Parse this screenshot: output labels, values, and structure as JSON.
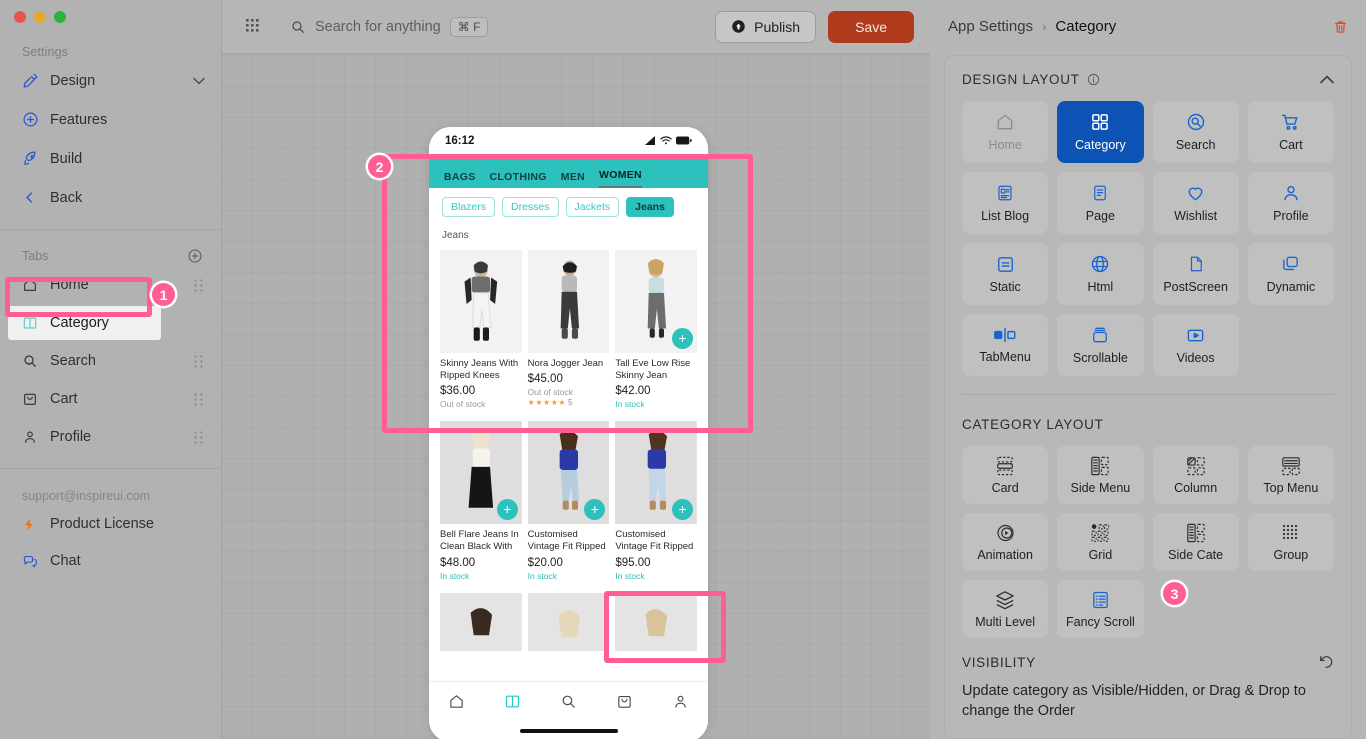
{
  "sidebar": {
    "settings_label": "Settings",
    "settings_items": [
      {
        "label": "Design",
        "icon": "paint-roller-icon",
        "trailing": "chevron-down-icon"
      },
      {
        "label": "Features",
        "icon": "plus-circle-icon",
        "trailing": ""
      },
      {
        "label": "Build",
        "icon": "rocket-icon",
        "trailing": ""
      },
      {
        "label": "Back",
        "icon": "chevron-left-icon",
        "trailing": ""
      }
    ],
    "tabs_label": "Tabs",
    "add_tab_icon": "plus-circle-icon",
    "tabs": [
      {
        "label": "Home",
        "icon": "home-icon",
        "selected": false
      },
      {
        "label": "Category",
        "icon": "category-icon",
        "selected": true
      },
      {
        "label": "Search",
        "icon": "search-icon",
        "selected": false
      },
      {
        "label": "Cart",
        "icon": "cart-icon",
        "selected": false
      },
      {
        "label": "Profile",
        "icon": "person-icon",
        "selected": false
      }
    ],
    "support_email": "support@inspireui.com",
    "links": [
      {
        "label": "Product License",
        "icon": "bolt-icon"
      },
      {
        "label": "Chat",
        "icon": "chat-icon"
      }
    ]
  },
  "topbar": {
    "apps_icon": "grid-apps-icon",
    "search_icon": "search-icon",
    "search_placeholder": "Search for anything",
    "search_shortcut": "⌘ F",
    "publish_label": "Publish",
    "publish_icon": "upload-circle-icon",
    "save_label": "Save",
    "save_color": "#b03b1c"
  },
  "breadcrumb": {
    "parent": "App Settings",
    "separator": "›",
    "current": "Category",
    "delete_icon": "trash-icon",
    "delete_color": "#d9432c"
  },
  "phone": {
    "status_time": "16:12",
    "status_icons": [
      "signal-icon",
      "wifi-icon",
      "battery-icon"
    ],
    "top_tabs": [
      "BAGS",
      "CLOTHING",
      "MEN",
      "WOMEN"
    ],
    "top_tab_active": "WOMEN",
    "accent_color": "#2cc1bd",
    "chips": [
      "Blazers",
      "Dresses",
      "Jackets",
      "Jeans"
    ],
    "chip_active": "Jeans",
    "section_title": "Jeans",
    "products_row1": [
      {
        "name": "Skinny Jeans With Ripped Knees",
        "price": "$36.00",
        "status": "Out of stock",
        "in_stock": false,
        "fab": false,
        "rating": ""
      },
      {
        "name": "Nora Jogger Jean",
        "price": "$45.00",
        "status": "Out of stock",
        "in_stock": false,
        "fab": false,
        "rating": "5"
      },
      {
        "name": "Tall Eve Low Rise Skinny Jean",
        "price": "$42.00",
        "status": "In stock",
        "in_stock": true,
        "fab": true,
        "rating": ""
      }
    ],
    "products_row2": [
      {
        "name": "Bell Flare Jeans In Clean Black With",
        "price": "$48.00",
        "status": "In stock",
        "in_stock": true,
        "fab": true,
        "rating": ""
      },
      {
        "name": "Customised Vintage Fit Ripped",
        "price": "$20.00",
        "status": "In stock",
        "in_stock": true,
        "fab": true,
        "rating": ""
      },
      {
        "name": "Customised Vintage Fit Ripped",
        "price": "$95.00",
        "status": "In stock",
        "in_stock": true,
        "fab": true,
        "rating": ""
      }
    ],
    "bottom_nav": [
      {
        "icon": "home-icon",
        "active": false
      },
      {
        "icon": "category-icon",
        "active": true
      },
      {
        "icon": "search-icon",
        "active": false
      },
      {
        "icon": "bag-icon",
        "active": false
      },
      {
        "icon": "person-icon",
        "active": false
      }
    ]
  },
  "design_layout": {
    "title": "DESIGN LAYOUT",
    "info_icon": "info-icon",
    "collapse_icon": "chevron-up-icon",
    "active_color": "#0d52b5",
    "tiles": [
      {
        "label": "Home",
        "icon": "home-icon",
        "state": "dim"
      },
      {
        "label": "Category",
        "icon": "grid-4-icon",
        "state": "active"
      },
      {
        "label": "Search",
        "icon": "search-circle-icon",
        "state": "normal"
      },
      {
        "label": "Cart",
        "icon": "cart-icon",
        "state": "normal"
      },
      {
        "label": "List Blog",
        "icon": "list-blog-icon",
        "state": "normal"
      },
      {
        "label": "Page",
        "icon": "page-icon",
        "state": "normal"
      },
      {
        "label": "Wishlist",
        "icon": "heart-icon",
        "state": "normal"
      },
      {
        "label": "Profile",
        "icon": "person-icon",
        "state": "normal"
      },
      {
        "label": "Static",
        "icon": "static-icon",
        "state": "normal"
      },
      {
        "label": "Html",
        "icon": "globe-icon",
        "state": "normal"
      },
      {
        "label": "PostScreen",
        "icon": "document-icon",
        "state": "normal"
      },
      {
        "label": "Dynamic",
        "icon": "layers-icon",
        "state": "normal"
      },
      {
        "label": "TabMenu",
        "icon": "tabmenu-icon",
        "state": "normal"
      },
      {
        "label": "Scrollable",
        "icon": "scrollable-icon",
        "state": "normal"
      },
      {
        "label": "Videos",
        "icon": "video-icon",
        "state": "normal"
      }
    ]
  },
  "category_layout": {
    "title": "CATEGORY LAYOUT",
    "tiles": [
      {
        "label": "Card",
        "icon": "card-layout-icon",
        "selected": false
      },
      {
        "label": "Side Menu",
        "icon": "side-menu-icon",
        "selected": false
      },
      {
        "label": "Column",
        "icon": "column-icon",
        "selected": false
      },
      {
        "label": "Top Menu",
        "icon": "top-menu-icon",
        "selected": false
      },
      {
        "label": "Animation",
        "icon": "animation-icon",
        "selected": false
      },
      {
        "label": "Grid",
        "icon": "grid-dots-icon",
        "selected": false
      },
      {
        "label": "Side Cate",
        "icon": "side-cate-icon",
        "selected": false
      },
      {
        "label": "Group",
        "icon": "group-dots-icon",
        "selected": false
      },
      {
        "label": "Multi Level",
        "icon": "multi-level-icon",
        "selected": false
      },
      {
        "label": "Fancy Scroll",
        "icon": "fancy-scroll-icon",
        "selected": true
      }
    ]
  },
  "visibility": {
    "title": "VISIBILITY",
    "reset_icon": "undo-icon",
    "description": "Update category as Visible/Hidden, or Drag & Drop to change the Order"
  },
  "annotations": {
    "color": "#ff5e93",
    "badges": [
      {
        "number": "1",
        "target": "sidebar-tab-category"
      },
      {
        "number": "2",
        "target": "phone-category-preview"
      },
      {
        "number": "3",
        "target": "category-layout-fancy-scroll"
      }
    ]
  }
}
